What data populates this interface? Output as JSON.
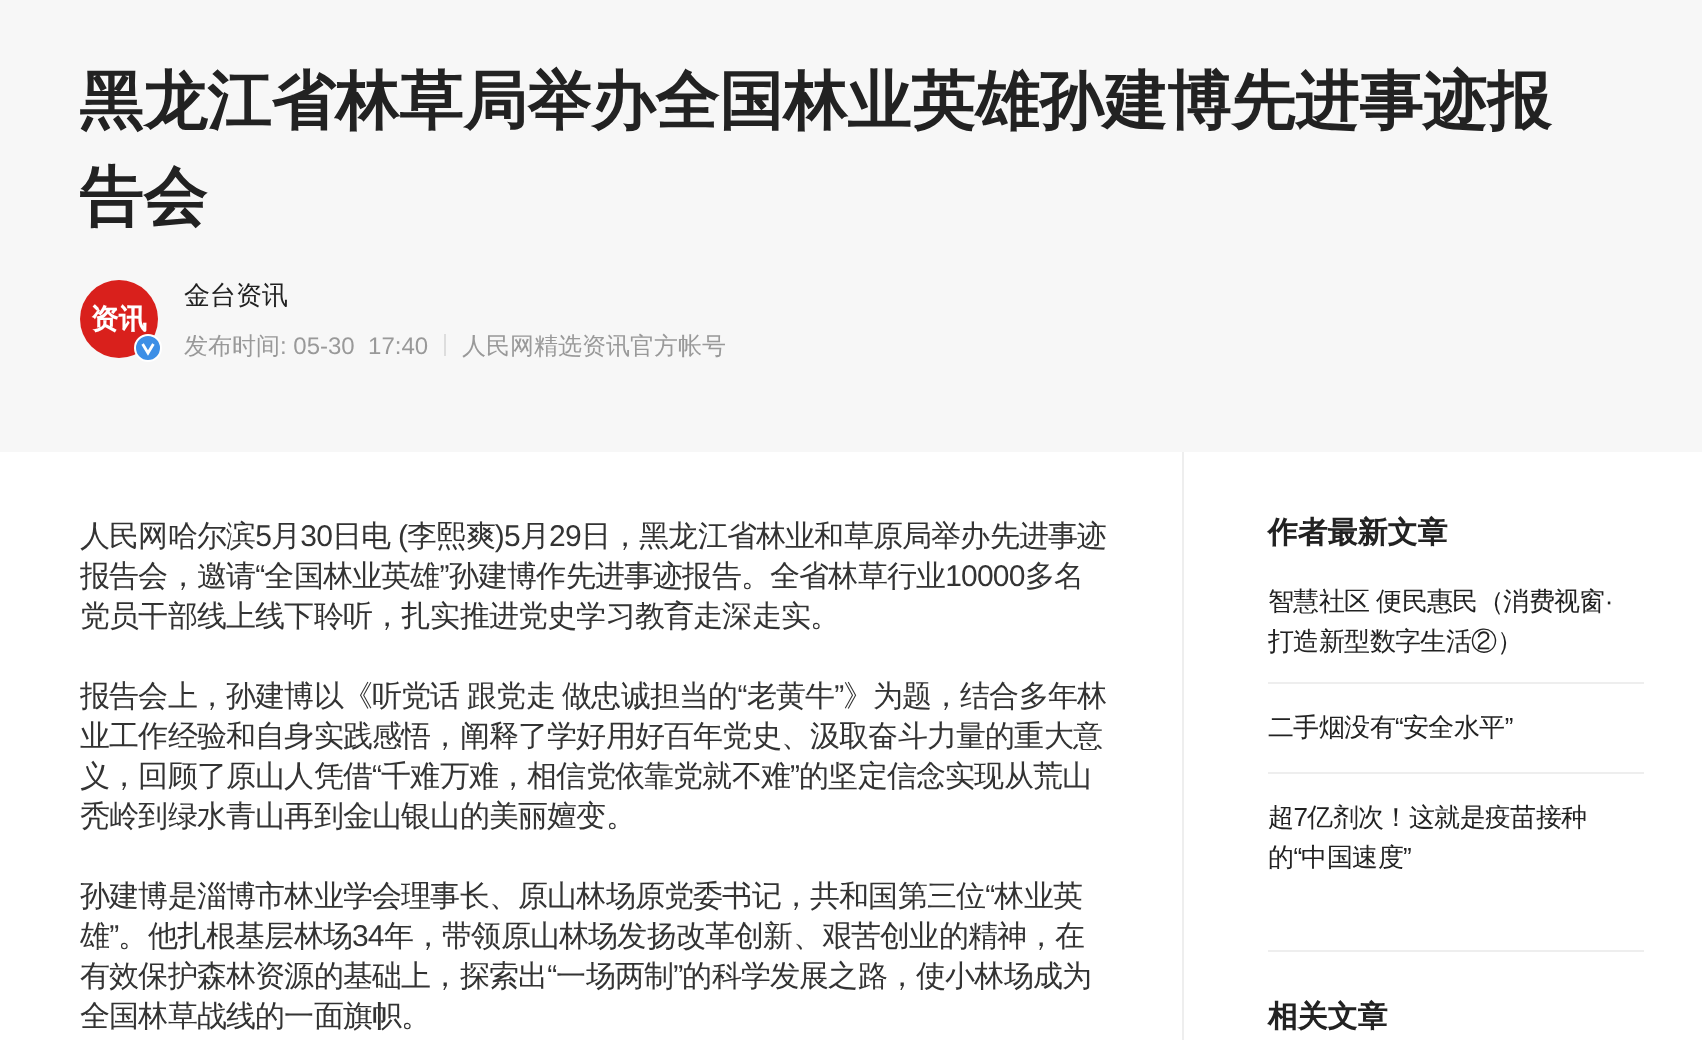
{
  "title": "黑龙江省林草局举办全国林业英雄孙建博先进事迹报告会",
  "author": {
    "avatar_text": "资讯",
    "verified": true,
    "name": "金台资讯",
    "publish_label": "发布时间: 05-30  17:40",
    "account_note": "人民网精选资讯官方帐号"
  },
  "paragraphs": [
    "人民网哈尔滨5月30日电 (李熙爽)5月29日，黑龙江省林业和草原局举办先进事迹报告会，邀请“全国林业英雄”孙建博作先进事迹报告。全省林草行业10000多名党员干部线上线下聆听，扎实推进党史学习教育走深走实。",
    "报告会上，孙建博以《听党话 跟党走 做忠诚担当的“老黄牛”》为题，结合多年林业工作经验和自身实践感悟，阐释了学好用好百年党史、汲取奋斗力量的重大意义，回顾了原山人凭借“千难万难，相信党依靠党就不难”的坚定信念实现从荒山秃岭到绿水青山再到金山银山的美丽嬗变。",
    "孙建博是淄博市林业学会理事长、原山林场原党委书记，共和国第三位“林业英雄”。他扎根基层林场34年，带领原山林场发扬改革创新、艰苦创业的精神，在有效保护森林资源的基础上，探索出“一场两制”的科学发展之路，使小林场成为全国林草战线的一面旗帜。"
  ],
  "sidebar": {
    "heading": "作者最新文章",
    "articles": [
      "智慧社区 便民惠民（消费视窗·打造新型数字生活②）",
      "二手烟没有“安全水平”",
      "超7亿剂次！这就是疫苗接种的“中国速度”"
    ],
    "next_heading": "相关文章"
  }
}
